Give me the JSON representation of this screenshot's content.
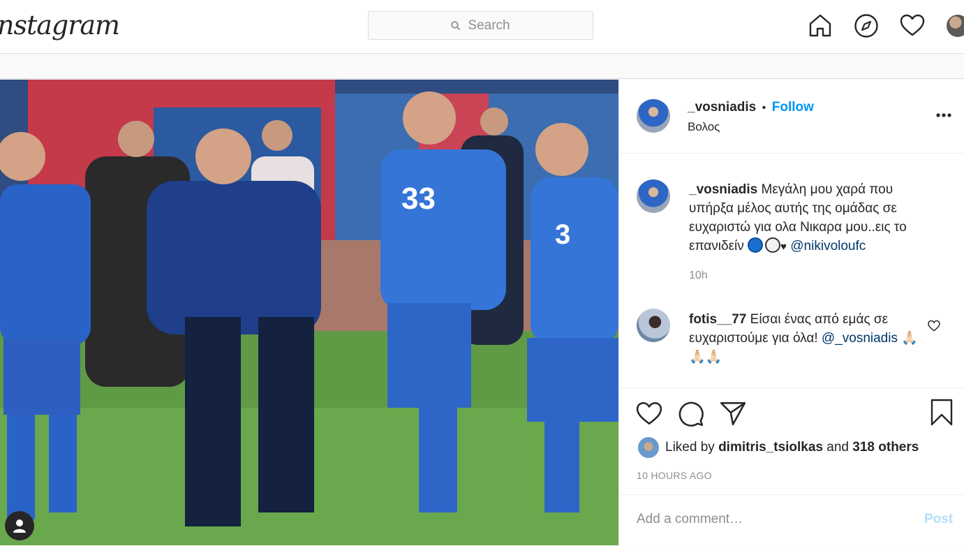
{
  "nav": {
    "logo": "nstagram",
    "search_placeholder": "Search",
    "icons": [
      "home-icon",
      "explore-icon",
      "activity-heart-icon",
      "profile-avatar"
    ]
  },
  "post": {
    "username": "_vosniadis",
    "separator": "•",
    "follow_label": "Follow",
    "location": "Βολος",
    "caption": {
      "username": "_vosniadis",
      "text": "Μεγάλη μου χαρά που υπήρξα μέλος αυτής της ομάδας σε ευχαριστώ για ολα Νικαρα μου..εις το επανιδείν",
      "heart": "♥",
      "mention": "@nikivoloufc",
      "time": "10h"
    },
    "comments": [
      {
        "username": "fotis__77",
        "text": "Είσαι ένας από εμάς σε ευχαριστούμε για όλα!",
        "mention": "@_vosniadis",
        "emoji": "🙏🏻🙏🏻🙏🏻"
      }
    ],
    "likes": {
      "prefix": "Liked by",
      "user": "dimitris_tsiolkas",
      "middle": "and",
      "others": "318 others"
    },
    "time_ago": "10 HOURS AGO",
    "add_comment_placeholder": "Add a comment…",
    "post_label": "Post"
  },
  "colors": {
    "accent": "#0095f6",
    "mention": "#00376b",
    "muted": "#8e8e8e",
    "post_disabled": "#b2dffc"
  }
}
